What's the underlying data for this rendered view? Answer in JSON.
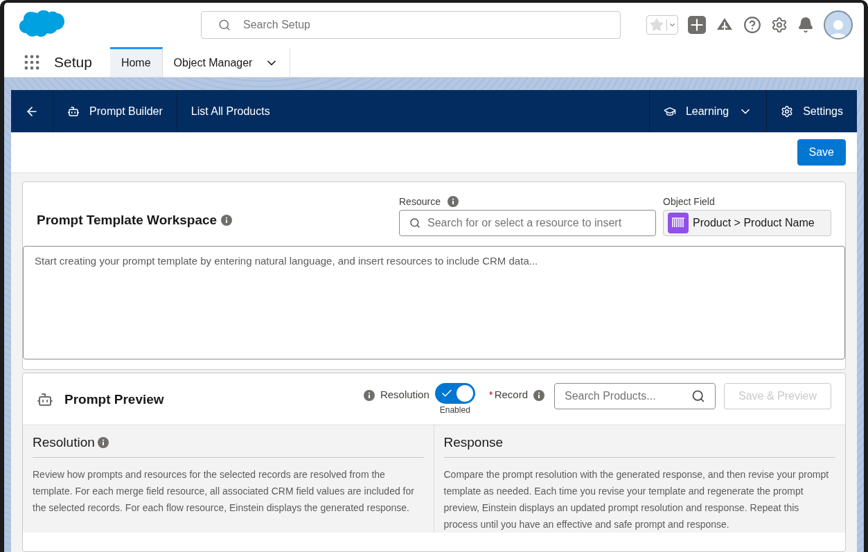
{
  "header": {
    "search_placeholder": "Search Setup"
  },
  "nav": {
    "app_name": "Setup",
    "tabs": [
      {
        "label": "Home",
        "selected": true,
        "has_menu": false
      },
      {
        "label": "Object Manager",
        "selected": false,
        "has_menu": true
      }
    ]
  },
  "builder_bar": {
    "title": "Prompt Builder",
    "template_name": "List All Products",
    "learning": "Learning",
    "settings": "Settings"
  },
  "save_button": "Save",
  "workspace": {
    "title": "Prompt Template Workspace",
    "resource_label": "Resource",
    "resource_placeholder": "Search for or select a resource to insert",
    "object_field_label": "Object Field",
    "object_field_value": "Product > Product Name",
    "editor_placeholder": "Start creating your prompt template by entering natural language, and insert resources to include CRM data..."
  },
  "preview": {
    "title": "Prompt Preview",
    "resolution_label": "Resolution",
    "toggle": {
      "on": true,
      "caption": "Enabled"
    },
    "record_label": "Record",
    "record_required": true,
    "required_mark": "*",
    "record_placeholder": "Search Products...",
    "save_preview": {
      "label": "Save & Preview",
      "disabled": true
    },
    "panels": [
      {
        "title": "Resolution",
        "info": true,
        "text": "Review how prompts and resources for the selected records are resolved from the template. For each merge field resource, all associated CRM field values are included for the selected records. For each flow resource, Einstein displays the generated response."
      },
      {
        "title": "Response",
        "info": false,
        "text": "Compare the prompt resolution with the generated response, and then revise your prompt template as needed. Each time you revise your template and regenerate the prompt preview, Einstein displays an updated prompt resolution and response. Repeat this process until you have an effective and safe prompt and response."
      }
    ]
  }
}
